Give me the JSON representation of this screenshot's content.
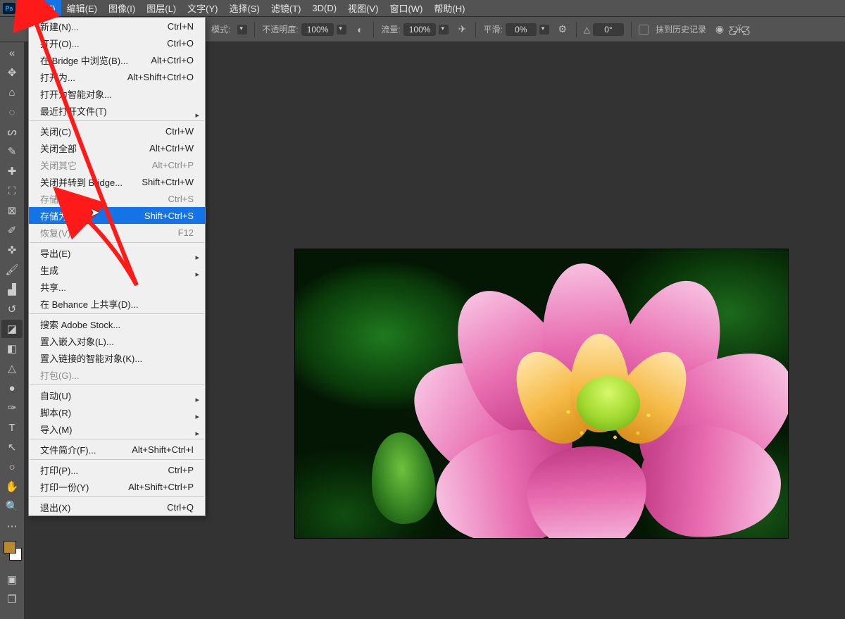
{
  "menubar": {
    "items": [
      {
        "label": "文件(F)",
        "open": true
      },
      {
        "label": "编辑(E)"
      },
      {
        "label": "图像(I)"
      },
      {
        "label": "图层(L)"
      },
      {
        "label": "文字(Y)"
      },
      {
        "label": "选择(S)"
      },
      {
        "label": "滤镜(T)"
      },
      {
        "label": "3D(D)"
      },
      {
        "label": "视图(V)"
      },
      {
        "label": "窗口(W)"
      },
      {
        "label": "帮助(H)"
      }
    ]
  },
  "optbar": {
    "mode_label": "模式:",
    "opacity_label": "不透明度:",
    "opacity": "100%",
    "flow_label": "流量:",
    "flow": "100%",
    "smooth_label": "平滑:",
    "smooth": "0%",
    "angle_label": "△",
    "angle": "0°",
    "history_label": "抹到历史记录"
  },
  "dropdown": {
    "rows": [
      {
        "label": "新建(N)...",
        "short": "Ctrl+N"
      },
      {
        "label": "打开(O)...",
        "short": "Ctrl+O"
      },
      {
        "label": "在 Bridge 中浏览(B)...",
        "short": "Alt+Ctrl+O"
      },
      {
        "label": "打开为...",
        "short": "Alt+Shift+Ctrl+O"
      },
      {
        "label": "打开为智能对象..."
      },
      {
        "label": "最近打开文件(T)",
        "sub": true
      },
      {
        "sep": true
      },
      {
        "label": "关闭(C)",
        "short": "Ctrl+W"
      },
      {
        "label": "关闭全部",
        "short": "Alt+Ctrl+W"
      },
      {
        "label": "关闭其它",
        "short": "Alt+Ctrl+P",
        "disabled": true
      },
      {
        "label": "关闭并转到 Bridge...",
        "short": "Shift+Ctrl+W"
      },
      {
        "label": "存储(S)",
        "short": "Ctrl+S",
        "disabled": true
      },
      {
        "label": "存储为(A)...",
        "short": "Shift+Ctrl+S",
        "hi": true
      },
      {
        "label": "恢复(V)",
        "short": "F12",
        "disabled": true
      },
      {
        "sep": true
      },
      {
        "label": "导出(E)",
        "sub": true
      },
      {
        "label": "生成",
        "sub": true
      },
      {
        "label": "共享..."
      },
      {
        "label": "在 Behance 上共享(D)..."
      },
      {
        "sep": true
      },
      {
        "label": "搜索 Adobe Stock..."
      },
      {
        "label": "置入嵌入对象(L)..."
      },
      {
        "label": "置入链接的智能对象(K)..."
      },
      {
        "label": "打包(G)...",
        "disabled": true
      },
      {
        "sep": true
      },
      {
        "label": "自动(U)",
        "sub": true
      },
      {
        "label": "脚本(R)",
        "sub": true
      },
      {
        "label": "导入(M)",
        "sub": true
      },
      {
        "sep": true
      },
      {
        "label": "文件简介(F)...",
        "short": "Alt+Shift+Ctrl+I"
      },
      {
        "sep": true
      },
      {
        "label": "打印(P)...",
        "short": "Ctrl+P"
      },
      {
        "label": "打印一份(Y)",
        "short": "Alt+Shift+Ctrl+P"
      },
      {
        "sep": true
      },
      {
        "label": "退出(X)",
        "short": "Ctrl+Q"
      }
    ]
  },
  "tools": [
    "move",
    "home",
    "marquee",
    "lasso",
    "brush",
    "heal",
    "bowtie",
    "stamp",
    "crop",
    "eyedropper",
    "eraser",
    "pen",
    "stamp2",
    "history",
    "gradient",
    "impression",
    "teardrop",
    "zoom",
    "ellipses",
    "type",
    "path",
    "ellipse",
    "hand",
    "magnify"
  ]
}
